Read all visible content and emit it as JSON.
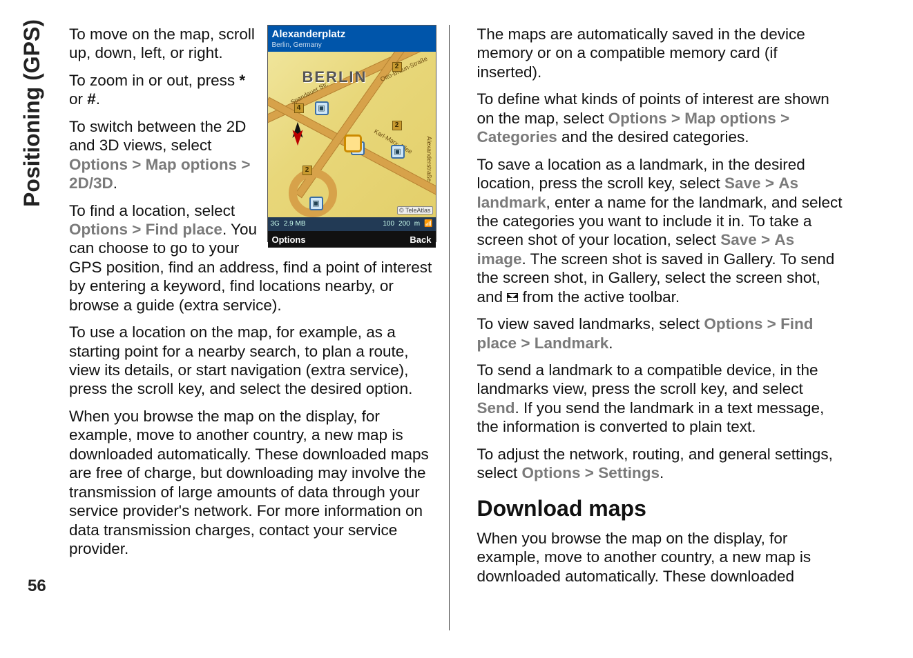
{
  "sidebar": {
    "section": "Positioning (GPS)",
    "page": "56"
  },
  "left": {
    "p1a": "To move on the map, scroll up, down, left, or right.",
    "p2a": "To zoom in or out, press ",
    "p2b": "*",
    "p2c": " or ",
    "p2d": "#",
    "p2e": ".",
    "p3a": "To switch between the 2D and 3D views, select ",
    "p3_opt": "Options",
    "gt": ">",
    "p3_map": "Map options",
    "p3_23d": "2D/3D",
    "dot": ".",
    "p4a": "To find a location, select ",
    "p4_find": "Find place",
    "p4b": ". You can choose to go to your GPS position, find an address, find a point of interest by entering a keyword, find locations nearby, or browse a guide (extra service).",
    "p5": "To use a location on the map, for example, as a starting point for a nearby search, to plan a route, view its details, or start navigation (extra service), press the scroll key, and select the desired option.",
    "p6": "When you browse the map on the display, for example, move to another country, a new map is downloaded automatically. These downloaded maps are free of charge, but downloading may involve the transmission of large amounts of data through your service provider's network. For more information on data transmission charges, contact your service provider."
  },
  "right": {
    "p1": "The maps are automatically saved in the device memory or on a compatible memory card (if inserted).",
    "p2a": "To define what kinds of points of interest are shown on the map, select ",
    "opt": "Options",
    "gt": ">",
    "mapopt": "Map options",
    "cats": "Categories",
    "p2b": " and the desired categories.",
    "p3a": "To save a location as a landmark, in the desired location, press the scroll key, select ",
    "save": "Save",
    "aslm": "As landmark",
    "p3b": ", enter a name for the landmark, and select the categories you want to include it in. To take a screen shot of your location, select ",
    "asimg": "As image",
    "p3c": ". The screen shot is saved in Gallery. To send the screen shot, in Gallery, select the screen shot, and ",
    "p3d": " from the active toolbar.",
    "p4a": "To view saved landmarks, select ",
    "findpl": "Find place",
    "lm": "Landmark",
    "p5a": "To send a landmark to a compatible device, in the landmarks view, press the scroll key, and select ",
    "send": "Send",
    "p5b": ". If you send the landmark in a text message, the information is converted to plain text.",
    "p6a": "To adjust the network, routing, and general settings, select ",
    "settings": "Settings",
    "h2": "Download maps",
    "p7": "When you browse the map on the display, for example, move to another country, a new map is downloaded automatically. These downloaded"
  },
  "map": {
    "title": "Alexanderplatz",
    "subtitle": "Berlin, Germany",
    "cityLabel": "BERLIN",
    "copyright": "© TeleAtlas",
    "status_net": "3G",
    "status_size": "2.9 MB",
    "scale1": "100",
    "scale2": "200",
    "scale_unit": "m",
    "soft_left": "Options",
    "soft_right": "Back",
    "numbers": {
      "n1": "2",
      "n2": "2",
      "n3": "2",
      "n4": "4"
    },
    "roads": {
      "r1": "Otto-Braun-Straße",
      "r2": "Karl-Marx-Allee",
      "r3": "Spandauer Str.",
      "r4": "Alexanderstraße"
    }
  }
}
